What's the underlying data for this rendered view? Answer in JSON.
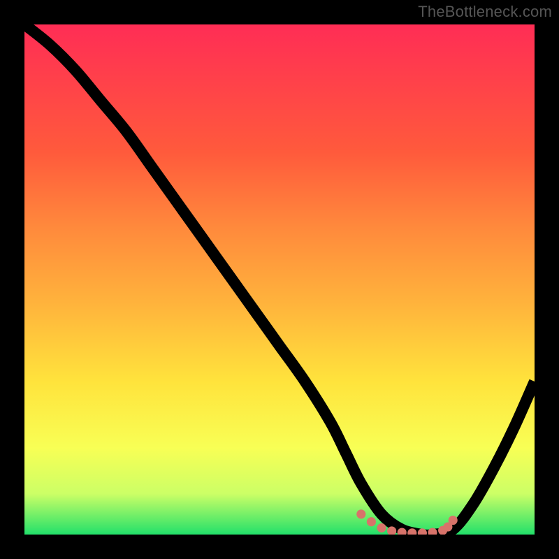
{
  "watermark": "TheBottleneck.com",
  "colors": {
    "gradient_top": "#ff2d55",
    "gradient_mid1": "#ff5a3c",
    "gradient_mid2": "#ff8a3c",
    "gradient_mid3": "#ffb43c",
    "gradient_mid4": "#ffe33c",
    "gradient_mid5": "#f8ff55",
    "gradient_mid6": "#ccff66",
    "gradient_bottom": "#22e06a",
    "curve": "#000000",
    "marker": "#d8736a",
    "background": "#000000"
  },
  "chart_data": {
    "type": "line",
    "title": "",
    "xlabel": "",
    "ylabel": "",
    "xlim": [
      0,
      100
    ],
    "ylim": [
      0,
      100
    ],
    "series": [
      {
        "name": "bottleneck-curve",
        "x": [
          0,
          5,
          10,
          15,
          20,
          25,
          30,
          35,
          40,
          45,
          50,
          55,
          60,
          63,
          66,
          70,
          74,
          78,
          80,
          84,
          88,
          92,
          96,
          100
        ],
        "y": [
          100,
          96,
          91,
          85,
          79,
          72,
          65,
          58,
          51,
          44,
          37,
          30,
          22,
          16,
          10,
          4,
          1,
          0,
          0,
          1,
          6,
          13,
          21,
          30
        ]
      }
    ],
    "markers": {
      "name": "valley-dots",
      "x": [
        66,
        68,
        70,
        72,
        74,
        76,
        78,
        80,
        82,
        83,
        84
      ],
      "y": [
        4,
        2.5,
        1.3,
        0.7,
        0.4,
        0.3,
        0.3,
        0.4,
        0.8,
        1.5,
        2.8
      ]
    }
  }
}
